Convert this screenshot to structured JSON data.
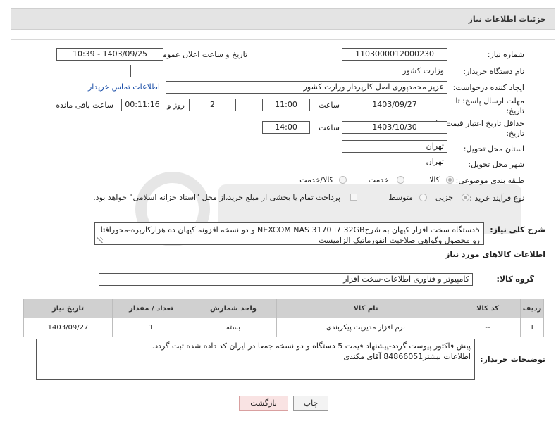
{
  "header": {
    "title": "جزئیات اطلاعات نیاز"
  },
  "fields": {
    "need_number_label": "شماره نیاز:",
    "need_number": "1103000012000230",
    "announce_label": "تاریخ و ساعت اعلان عمومی:",
    "announce_value": "1403/09/25 - 10:39",
    "buyer_org_label": "نام دستگاه خریدار:",
    "buyer_org": "وزارت کشور",
    "creator_label": "ایجاد کننده درخواست:",
    "creator": "عزیز محمدپوری اصل کارپرداز وزارت کشور",
    "contact_link": "اطلاعات تماس خریدار",
    "reply_deadline_label_1": "مهلت ارسال پاسخ: تا",
    "reply_deadline_label_2": "تاریخ:",
    "reply_date": "1403/09/27",
    "time_label": "ساعت",
    "reply_time": "11:00",
    "days_value": "2",
    "days_label": "روز و",
    "remaining_time": "00:11:16",
    "remaining_label": "ساعت باقی مانده",
    "price_valid_label_1": "حداقل تاریخ اعتبار قیمت: تا",
    "price_valid_label_2": "تاریخ:",
    "price_date": "1403/10/30",
    "price_time": "14:00",
    "province_label": "استان محل تحویل:",
    "province": "تهران",
    "city_label": "شهر محل تحویل:",
    "city": "تهران",
    "category_label": "طبقه بندی موضوعی:",
    "category_options": [
      "کالا",
      "خدمت",
      "کالا/خدمت"
    ],
    "purchase_type_label": "نوع فرآیند خرید :",
    "purchase_options": [
      "جزیی",
      "متوسط"
    ],
    "payment_note": "پرداخت تمام یا بخشی از مبلغ خرید،از محل \"اسناد خزانه اسلامی\" خواهد بود."
  },
  "summary": {
    "label": "شرح کلی نیاز:",
    "text": "5دستگاه سخت افزار کیهان به شرحNEXCOM NAS 3170 i7 32GB و دو نسخه افزونه کیهان ده هزارکاربره-محورافتا رو محصول وگواهی صلاحیت انفورماتیک الزامیست"
  },
  "goods": {
    "section_title": "اطلاعات کالاهای مورد نیاز",
    "group_label": "گروه کالا:",
    "group_value": "کامپیوتر و فناوری اطلاعات-سخت افزار",
    "columns": [
      "ردیف",
      "کد کالا",
      "نام کالا",
      "واحد شمارش",
      "تعداد / مقدار",
      "تاریخ نیاز"
    ],
    "rows": [
      {
        "index": "1",
        "code": "--",
        "name": "نرم افزار مدیریت پیکربندی",
        "unit": "بسته",
        "qty": "1",
        "date": "1403/09/27"
      }
    ]
  },
  "buyer_notes": {
    "label": "توضیحات خریدار:",
    "line1": "پیش فاکتور پیوست گردد-پیشنهاد قیمت 5 دستگاه و دو نسخه جمعا در ایران کد داده شده ثبت گردد.",
    "line2": "اطلاعات بیشتر84866051 آقای مکندی"
  },
  "buttons": {
    "print": "چاپ",
    "back": "بازگشت"
  },
  "colors": {
    "link": "#1a4ea8",
    "back_button_bg": "#f9e3e3",
    "back_button_border": "#d9a0a0"
  }
}
